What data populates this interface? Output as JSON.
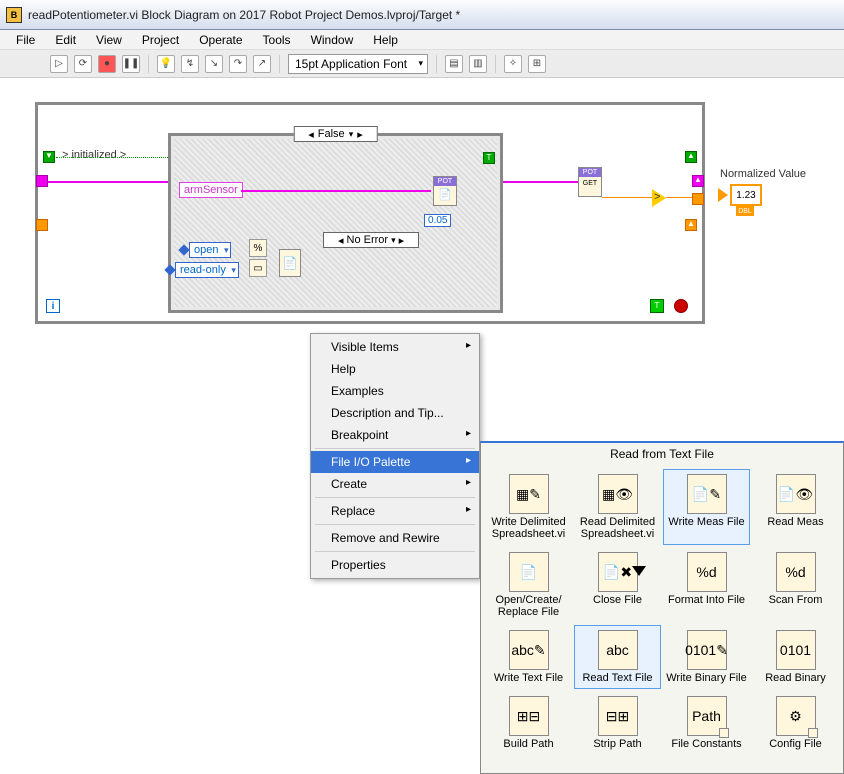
{
  "window": {
    "title": "readPotentiometer.vi Block Diagram on 2017 Robot Project Demos.lvproj/Target *"
  },
  "menubar": {
    "items": [
      "File",
      "Edit",
      "View",
      "Project",
      "Operate",
      "Tools",
      "Window",
      "Help"
    ]
  },
  "toolbar": {
    "font": "15pt Application Font"
  },
  "diagram": {
    "init_label": "> initialized >",
    "case_value": "False",
    "arm_sensor": "armSensor",
    "pot_set": "POT",
    "pot_get": "GET",
    "pot_hdr": "POT",
    "delay_value": "0.05",
    "error_case": "No Error",
    "ring_open": "open",
    "ring_readonly": "read-only",
    "normalized_label": "Normalized Value",
    "ind_value": "1.23",
    "ind_type": "DBL",
    "bool_true": "T"
  },
  "context_menu": {
    "items": [
      {
        "label": "Visible Items",
        "arrow": true
      },
      {
        "label": "Help"
      },
      {
        "label": "Examples"
      },
      {
        "label": "Description and Tip..."
      },
      {
        "label": "Breakpoint",
        "arrow": true
      },
      {
        "sep": true
      },
      {
        "label": "File I/O Palette",
        "arrow": true,
        "selected": true
      },
      {
        "label": "Create",
        "arrow": true
      },
      {
        "sep": true
      },
      {
        "label": "Replace",
        "arrow": true
      },
      {
        "sep": true
      },
      {
        "label": "Remove and Rewire"
      },
      {
        "sep": true
      },
      {
        "label": "Properties"
      }
    ]
  },
  "palette": {
    "title": "Read from Text File",
    "items": [
      {
        "label": "Write Delimited Spreadsheet.vi",
        "glyph": "▦✎"
      },
      {
        "label": "Read Delimited Spreadsheet.vi",
        "glyph": "▦👁"
      },
      {
        "label": "Write Meas File",
        "glyph": "📄✎",
        "selected": true
      },
      {
        "label": "Read Meas",
        "glyph": "📄👁"
      },
      {
        "label": "Open/Create/ Replace File",
        "glyph": "📄"
      },
      {
        "label": "Close File",
        "glyph": "📄✖"
      },
      {
        "label": "Format Into File",
        "glyph": "%d"
      },
      {
        "label": "Scan From",
        "glyph": "%d"
      },
      {
        "label": "Write Text File",
        "glyph": "abc✎"
      },
      {
        "label": "Read Text File",
        "glyph": "abc",
        "selected2": true
      },
      {
        "label": "Write Binary File",
        "glyph": "0101✎"
      },
      {
        "label": "Read Binary",
        "glyph": "0101"
      },
      {
        "label": "Build Path",
        "glyph": "⊞⊟"
      },
      {
        "label": "Strip Path",
        "glyph": "⊟⊞"
      },
      {
        "label": "File Constants",
        "glyph": "Path",
        "sub": true
      },
      {
        "label": "Config File",
        "glyph": "⚙",
        "sub": true
      }
    ]
  }
}
